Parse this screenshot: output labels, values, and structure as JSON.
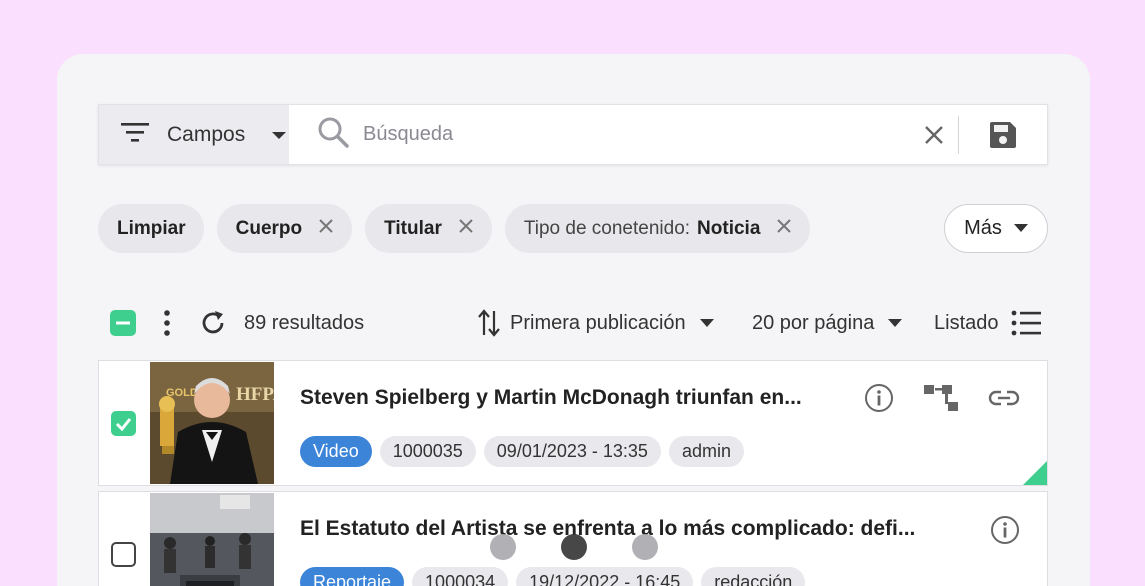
{
  "search": {
    "fields_label": "Campos",
    "placeholder": "Búsqueda"
  },
  "filters": {
    "clear_label": "Limpiar",
    "chips": [
      {
        "label": "",
        "value": "Cuerpo"
      },
      {
        "label": "",
        "value": "Titular"
      },
      {
        "label": "Tipo de conetenido:",
        "value": "Noticia"
      }
    ],
    "more_label": "Más"
  },
  "toolbar": {
    "results": "89 resultados",
    "sort_label": "Primera publicación",
    "per_page": "20 por página",
    "view_label": "Listado"
  },
  "results": [
    {
      "checked": true,
      "title": "Steven Spielberg y Martin McDonagh triunfan en...",
      "type": "Video",
      "id": "1000035",
      "date": "09/01/2023 - 13:35",
      "author": "admin"
    },
    {
      "checked": false,
      "title": "El Estatuto del Artista se enfrenta a lo más complicado: defi...",
      "type": "Reportaje",
      "id": "1000034",
      "date": "19/12/2022 - 16:45",
      "author": "redacción"
    }
  ],
  "colors": {
    "background": "#fbdfff",
    "accent_green": "#3ecf8e",
    "tag_blue": "#3b84d8"
  },
  "carousel": {
    "count": 3,
    "active": 2
  }
}
